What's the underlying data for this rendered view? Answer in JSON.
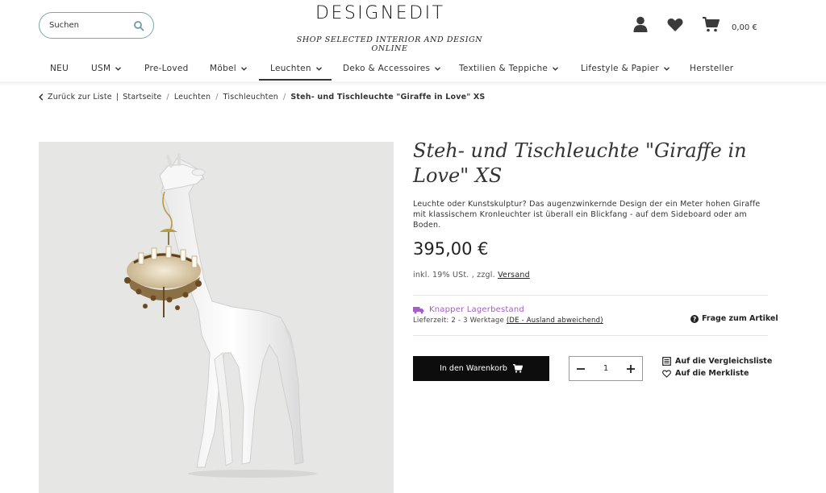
{
  "header": {
    "search_placeholder": "Suchen",
    "logo": "DESIGNEDIT",
    "tagline": "SHOP SELECTED INTERIOR AND DESIGN ONLINE",
    "cart_total": "0,00 €",
    "icons": [
      "search-icon",
      "user-icon",
      "heart-icon",
      "cart-icon"
    ]
  },
  "nav": {
    "items": [
      {
        "label": "NEU",
        "has_dropdown": false
      },
      {
        "label": "USM",
        "has_dropdown": true
      },
      {
        "label": "Pre-Loved",
        "has_dropdown": false
      },
      {
        "label": "Möbel",
        "has_dropdown": true
      },
      {
        "label": "Leuchten",
        "has_dropdown": true,
        "active": true
      },
      {
        "label": "Deko & Accessoires",
        "has_dropdown": true
      },
      {
        "label": "Textilien & Teppiche",
        "has_dropdown": true
      },
      {
        "label": "Lifestyle & Papier",
        "has_dropdown": true
      },
      {
        "label": "Hersteller",
        "has_dropdown": false
      }
    ]
  },
  "breadcrumb": {
    "back": "Zurück zur Liste",
    "items": [
      "Startseite",
      "Leuchten",
      "Tischleuchten"
    ],
    "current": "Steh- und Tischleuchte \"Giraffe in Love\" XS"
  },
  "product": {
    "title": "Steh- und Tischleuchte \"Giraffe in Love\" XS",
    "description": "Leuchte oder Kunstskulptur? Das augenzwinkernde Design der ein Meter hohen Giraffe mit klassischem Kronleuchter ist überall ein Blickfang - auf dem Sideboard oder am Boden.",
    "price": "395,00 €",
    "tax_prefix": "inkl. 19% USt. , zzgl.",
    "shipping_link": "Versand",
    "stock_status": "Knapper Lagerbestand",
    "stock_color": "#a35fc2",
    "delivery_prefix": "Lieferzeit: 2 - 3 Werktage",
    "delivery_link": "(DE - Ausland abweichend)",
    "question_label": "Frage zum Artikel",
    "add_to_cart": "In den Warenkorb",
    "quantity": "1",
    "compare_label": "Auf die Vergleichsliste",
    "wishlist_label": "Auf die Merkliste"
  }
}
